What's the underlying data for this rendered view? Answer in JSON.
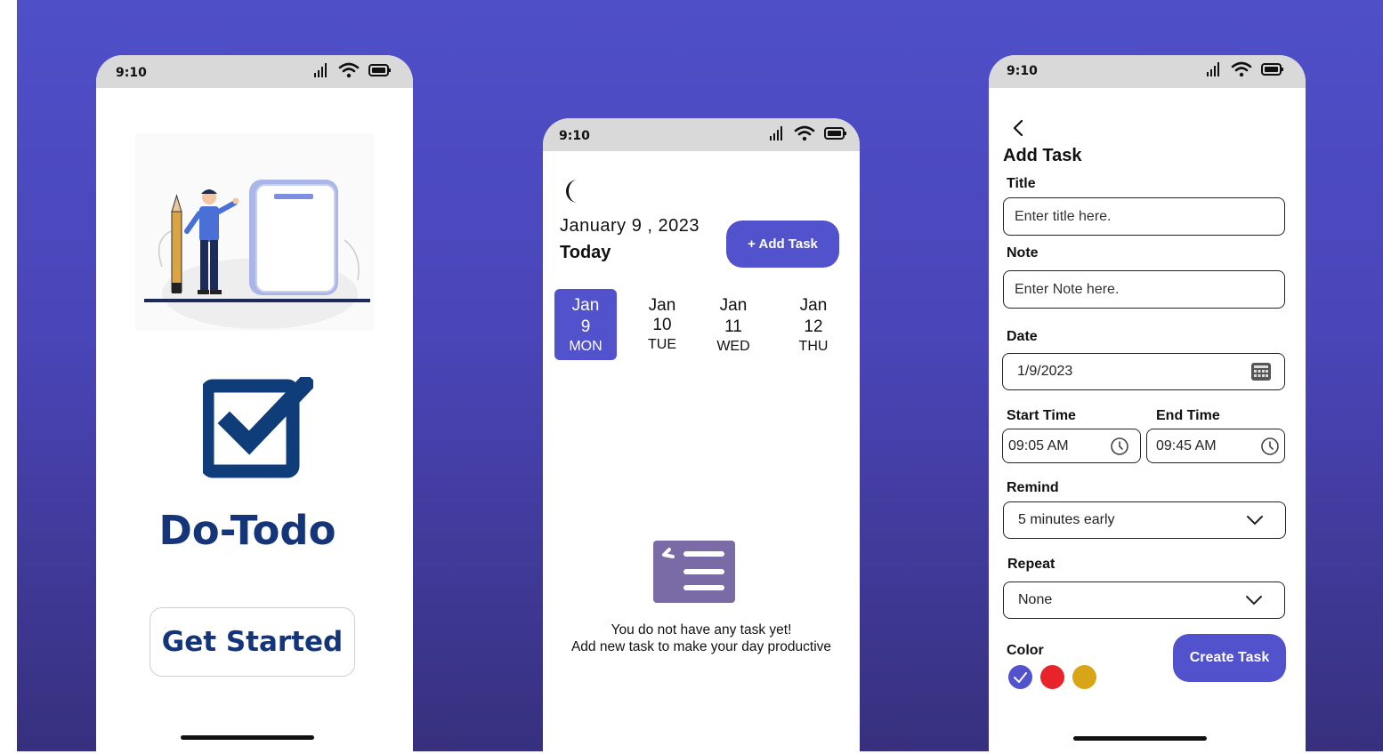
{
  "status_bar": {
    "time": "9:10"
  },
  "welcome_screen": {
    "app_name": "Do-Todo",
    "get_started_label": "Get Started"
  },
  "home_screen": {
    "date": "January 9 , 2023",
    "today_label": "Today",
    "add_task_label": "+ Add Task",
    "days": [
      {
        "month": "Jan",
        "day": "9",
        "weekday": "MON",
        "selected": true
      },
      {
        "month": "Jan",
        "day": "10",
        "weekday": "TUE",
        "selected": false
      },
      {
        "month": "Jan",
        "day": "11",
        "weekday": "WED",
        "selected": false
      },
      {
        "month": "Jan",
        "day": "12",
        "weekday": "THU",
        "selected": false
      }
    ],
    "empty_line1": "You do not have any task yet!",
    "empty_line2": "Add new task to make your day productive"
  },
  "add_task_screen": {
    "title": "Add Task",
    "title_label": "Title",
    "title_placeholder": "Enter title here.",
    "note_label": "Note",
    "note_placeholder": "Enter Note here.",
    "date_label": "Date",
    "date_value": "1/9/2023",
    "start_time_label": "Start Time",
    "start_time_value": "09:05 AM",
    "end_time_label": "End Time",
    "end_time_value": "09:45 AM",
    "remind_label": "Remind",
    "remind_value": "5 minutes early",
    "repeat_label": "Repeat",
    "repeat_value": "None",
    "color_label": "Color",
    "colors": [
      "#5152cc",
      "#e8232a",
      "#d8a516"
    ],
    "create_task_label": "Create Task"
  },
  "theme": {
    "accent": "#5152cc",
    "brand_navy": "#15357a"
  }
}
